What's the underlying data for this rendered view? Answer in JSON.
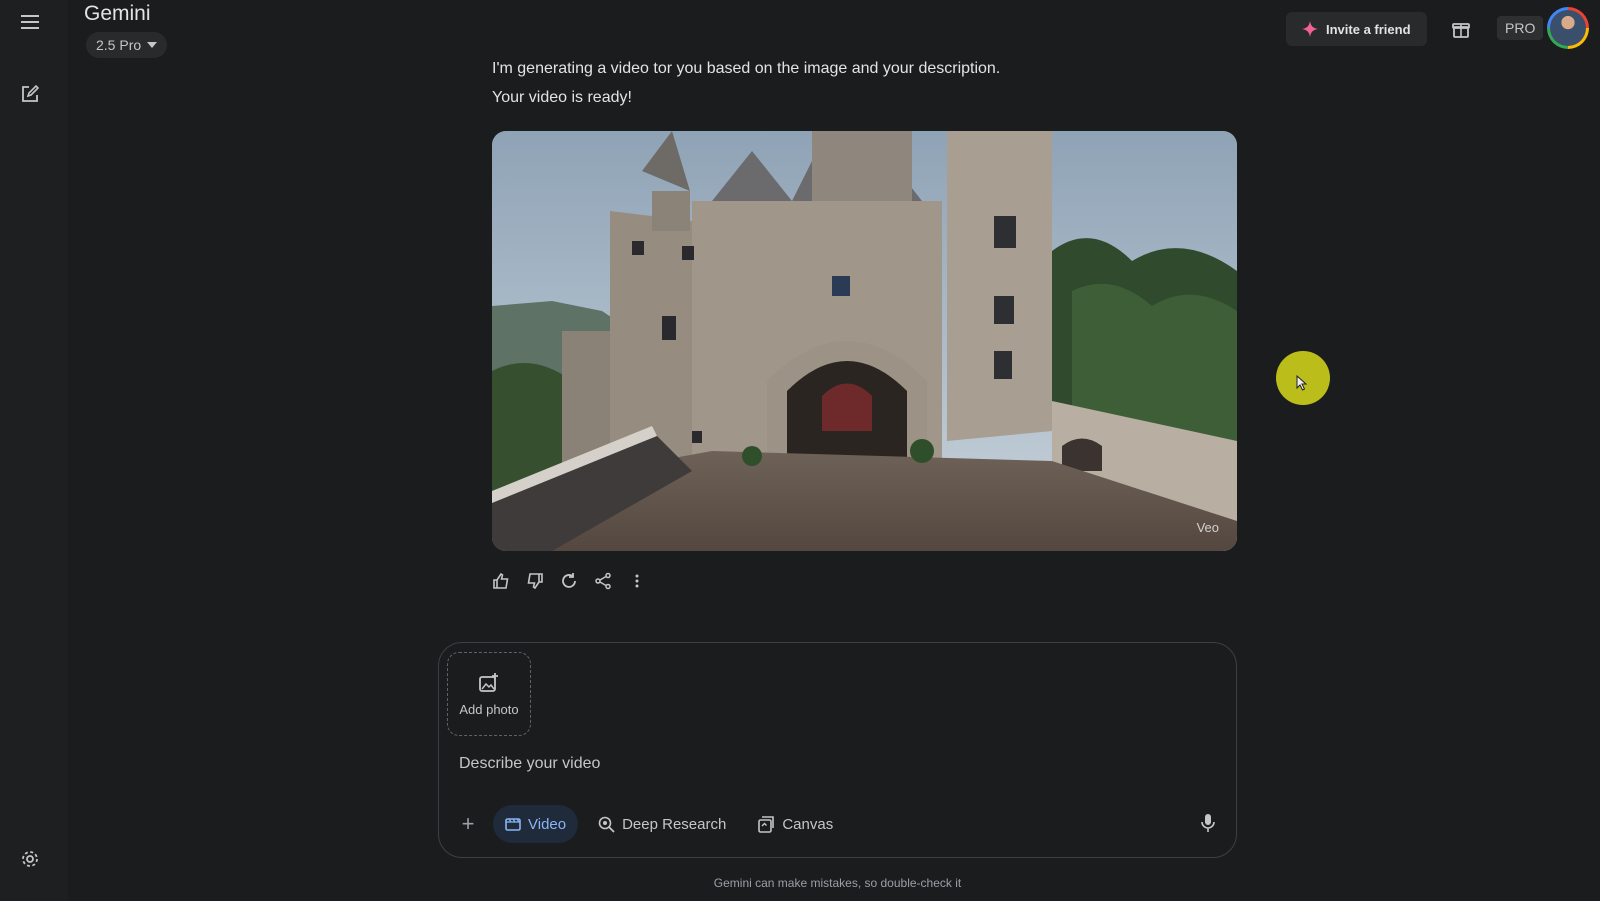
{
  "header": {
    "app_title": "Gemini",
    "model_label": "2.5 Pro",
    "invite_label": "Invite a friend",
    "pro_badge": "PRO"
  },
  "sidebar": {
    "items": [
      {
        "name": "menu-icon"
      },
      {
        "name": "new-chat-icon"
      },
      {
        "name": "settings-icon"
      }
    ]
  },
  "conversation": {
    "line1": "I'm generating a video tor you based on the image and your description.",
    "line2": "Your video is ready!",
    "video_watermark": "Veo"
  },
  "response_actions": [
    "thumbs-up-icon",
    "thumbs-down-icon",
    "regenerate-icon",
    "share-icon",
    "more-options-icon"
  ],
  "composer": {
    "add_photo_label": "Add photo",
    "placeholder": "Describe your video",
    "tools": [
      {
        "label": "Video",
        "icon": "video-icon",
        "active": true
      },
      {
        "label": "Deep Research",
        "icon": "deep-research-icon",
        "active": false
      },
      {
        "label": "Canvas",
        "icon": "canvas-icon",
        "active": false
      }
    ]
  },
  "footer": {
    "disclaimer": "Gemini can make mistakes, so double-check it"
  },
  "colors": {
    "background": "#1b1c1d",
    "sidebar": "#1e1f20",
    "accent_blue": "#8ab4f8",
    "cursor_highlight": "#c9cc1a"
  }
}
